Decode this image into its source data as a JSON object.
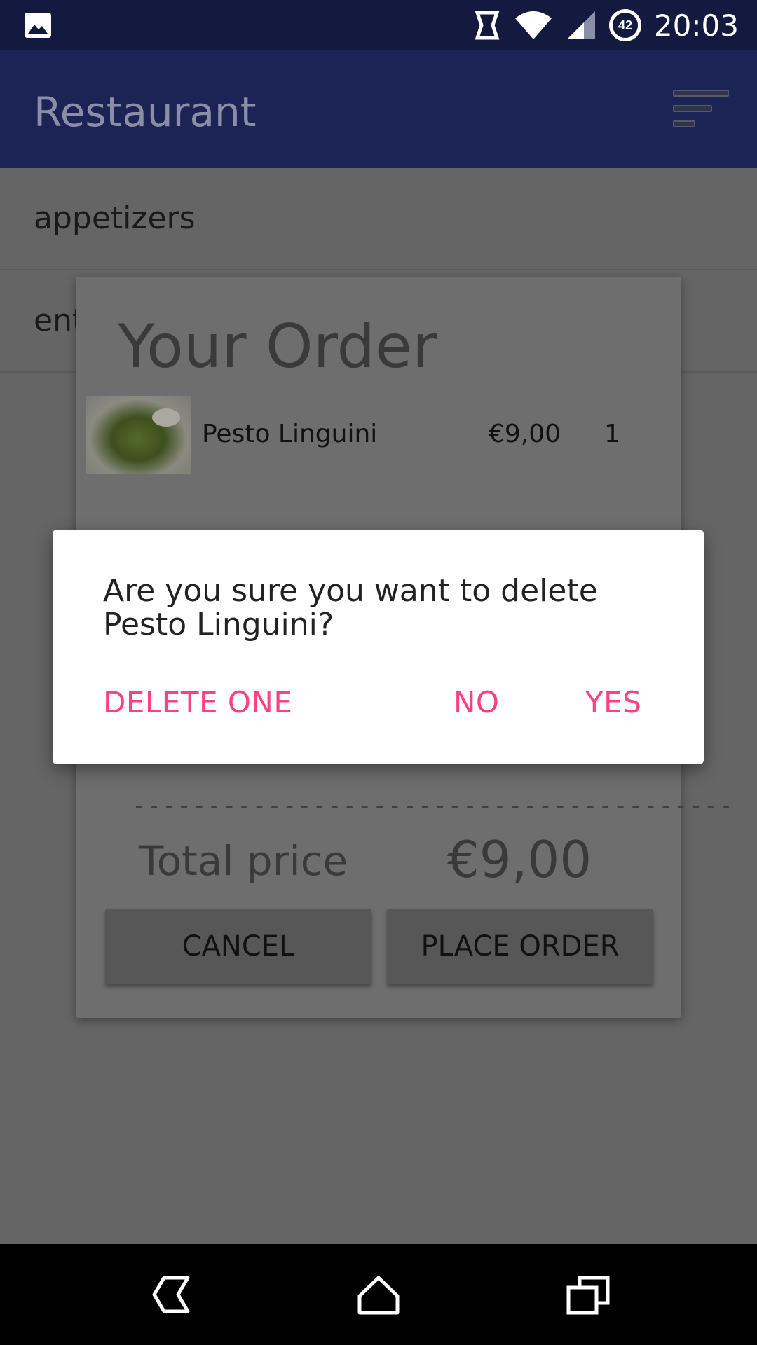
{
  "status_bar": {
    "time": "20:03",
    "battery_level": "42",
    "icons": [
      "image-icon",
      "sync-icon",
      "wifi-icon",
      "cellular-signal-icon",
      "battery-icon"
    ]
  },
  "app_bar": {
    "title": "Restaurant",
    "sort_icon": "sort-icon"
  },
  "categories": [
    {
      "label": "appetizers"
    },
    {
      "label": "entrees"
    }
  ],
  "order_dialog": {
    "title": "Your Order",
    "items": [
      {
        "name": "Pesto Linguini",
        "price": "€9,00",
        "quantity": "1"
      }
    ],
    "divider": "----------------------------------------",
    "total_label": "Total price",
    "total_value": "€9,00",
    "cancel_label": "CANCEL",
    "place_order_label": "PLACE ORDER"
  },
  "confirm_dialog": {
    "message": "Are you sure you want to delete Pesto Linguini?",
    "delete_one_label": "DELETE ONE",
    "no_label": "NO",
    "yes_label": "YES",
    "accent_color": "#ff4081"
  },
  "nav_bar": {
    "icons": [
      "back-icon",
      "home-icon",
      "recents-icon"
    ]
  },
  "colors": {
    "status_bar": "#141a3f",
    "app_bar": "#1c2456",
    "scrim_background": "#656565",
    "accent": "#ff4081"
  }
}
